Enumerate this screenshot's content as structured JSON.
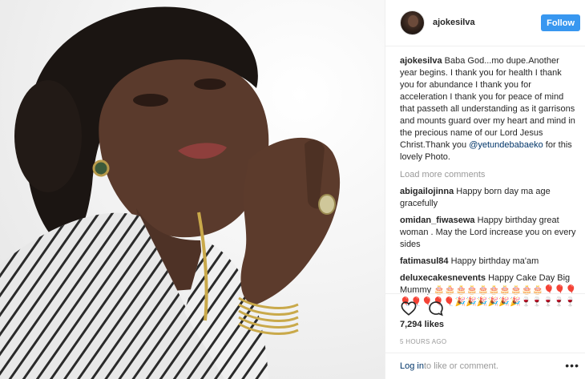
{
  "post": {
    "username": "ajokesilva",
    "follow_label": "Follow",
    "caption_user": "ajokesilva",
    "caption_text": " Baba God...mo dupe.Another year begins. I thank you for health I thank you for abundance I thank you for acceleration I thank you for peace of mind that passeth all understanding as it garrisons and mounts guard over my heart and mind in the precious name of our Lord Jesus Christ.Thank you ",
    "caption_mention": "@yetundebabaeko",
    "caption_tail": " for this lovely Photo.",
    "load_more": "Load more comments",
    "comments": [
      {
        "user": "abigailojinna",
        "text": " Happy born day ma age gracefully"
      },
      {
        "user": "omidan_fiwasewa",
        "text": " Happy birthday great woman . May the Lord increase you on every sides"
      },
      {
        "user": "fatimasul84",
        "text": " Happy birthday ma'am"
      },
      {
        "user": "deluxecakesnevents",
        "text": " Happy Cake Day Big Mummy 🎂🎂🎂🎂🎂🎂🎂🎂🎂🎂🎈🎈🎈🎈🎈🎈🎈🎈🎉🎉🎉🎉🎉🎉🍷🍷🍷🍷🍷"
      }
    ],
    "likes": "7,294 likes",
    "time": "5 HOURS AGO",
    "footer": {
      "login": "Log in",
      "rest": " to like or comment.",
      "more": "•••"
    },
    "icons": {
      "like": "heart-icon",
      "comment": "comment-icon",
      "more": "more-options-icon"
    },
    "colors": {
      "follow": "#3897f0",
      "link": "#003569",
      "muted": "#999999"
    }
  }
}
